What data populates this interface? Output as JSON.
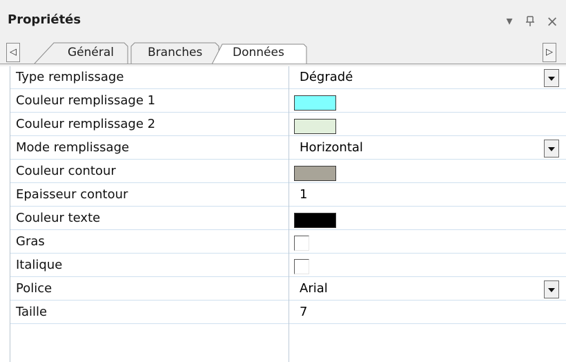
{
  "panel": {
    "title": "Propriétés",
    "dropdown_glyph": "▾",
    "pin_glyph": "ᵽ",
    "close_glyph": "×"
  },
  "tabs": {
    "scroll_left_glyph": "◁",
    "scroll_right_glyph": "▷",
    "items": [
      {
        "label": "Général",
        "active": false
      },
      {
        "label": "Branches",
        "active": false
      },
      {
        "label": "Données",
        "active": true
      }
    ]
  },
  "properties": [
    {
      "name": "Type remplissage",
      "kind": "dropdown",
      "value": "Dégradé"
    },
    {
      "name": "Couleur remplissage 1",
      "kind": "color",
      "color": "#80ffff"
    },
    {
      "name": "Couleur remplissage 2",
      "kind": "color",
      "color": "#e2f0dc"
    },
    {
      "name": "Mode remplissage",
      "kind": "dropdown",
      "value": "Horizontal"
    },
    {
      "name": "Couleur contour",
      "kind": "color",
      "color": "#a8a498"
    },
    {
      "name": "Epaisseur contour",
      "kind": "text",
      "value": "1"
    },
    {
      "name": "Couleur texte",
      "kind": "color",
      "color": "#000000"
    },
    {
      "name": "Gras",
      "kind": "checkbox",
      "checked": false
    },
    {
      "name": "Italique",
      "kind": "checkbox",
      "checked": false
    },
    {
      "name": "Police",
      "kind": "dropdown",
      "value": "Arial"
    },
    {
      "name": "Taille",
      "kind": "text",
      "value": "7"
    }
  ],
  "colors": {
    "chrome": "#f0f0f0",
    "grid_line": "#cfe0ef"
  }
}
